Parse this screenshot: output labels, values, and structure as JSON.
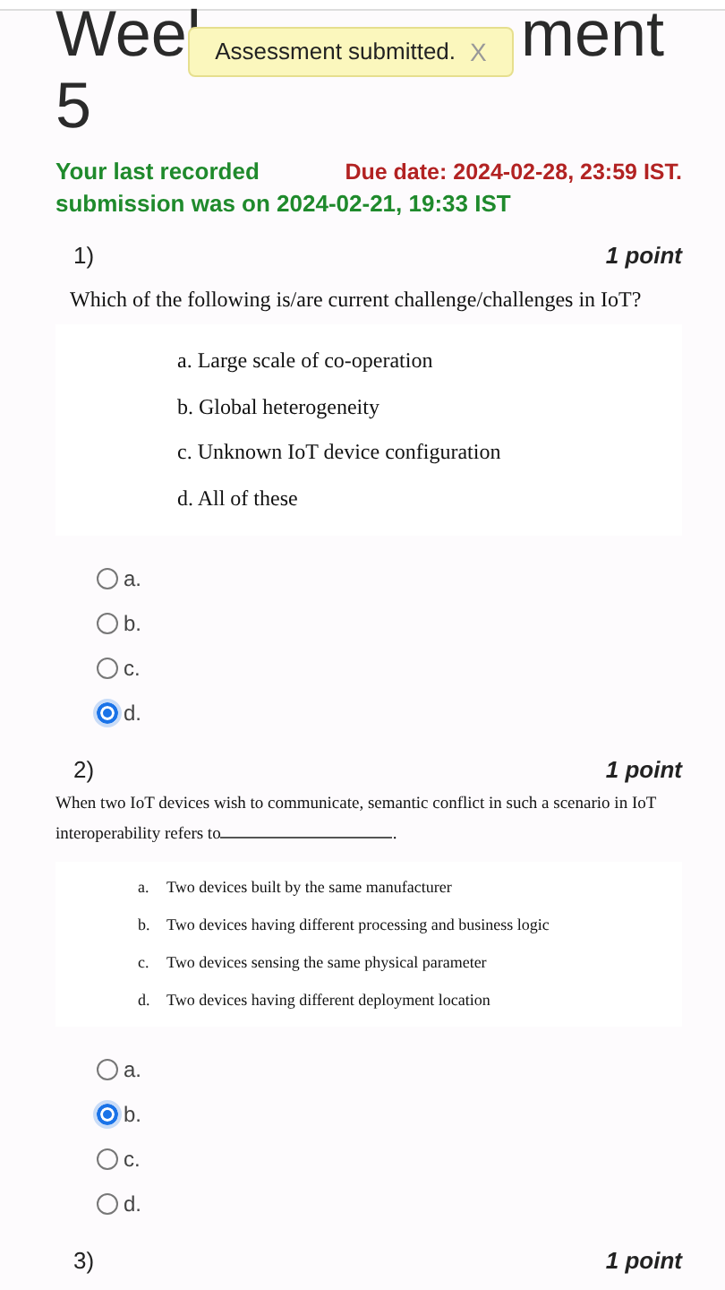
{
  "title": {
    "visible_start": "Weel",
    "visible_end": "ment",
    "line_2": "5"
  },
  "toast": {
    "message": "Assessment submitted.",
    "close": "X"
  },
  "submission_note": [
    "Your last recorded",
    "submission was on 2024-02-21, 19:33 IST"
  ],
  "due_date": "Due date: 2024-02-28, 23:59 IST.",
  "questions": [
    {
      "number": "1)",
      "points": "1 point",
      "kind": "plain",
      "text": "Which of the following is/are current challenge/challenges in IoT?",
      "options": [
        {
          "marker": "a.",
          "text": "Large scale of co-operation"
        },
        {
          "marker": "b.",
          "text": "Global heterogeneity"
        },
        {
          "marker": "c.",
          "text": "Unknown IoT device configuration"
        },
        {
          "marker": "d.",
          "text": "All of these"
        }
      ],
      "choices": [
        {
          "label": "a.",
          "selected": false
        },
        {
          "label": "b.",
          "selected": false
        },
        {
          "label": "c.",
          "selected": false
        },
        {
          "label": "d.",
          "selected": true
        }
      ]
    },
    {
      "number": "2)",
      "points": "1 point",
      "kind": "tabbed",
      "text": "When two IoT devices wish to communicate, semantic conflict in such a scenario in IoT interoperability refers to",
      "after_blank": ".",
      "options": [
        {
          "marker": "a.",
          "text": "Two devices built by the same manufacturer"
        },
        {
          "marker": "b.",
          "text": "Two devices having different processing and business logic"
        },
        {
          "marker": "c.",
          "text": "Two devices sensing the same physical parameter"
        },
        {
          "marker": "d.",
          "text": "Two devices having different deployment location"
        }
      ],
      "choices": [
        {
          "label": "a.",
          "selected": false
        },
        {
          "label": "b.",
          "selected": true
        },
        {
          "label": "c.",
          "selected": false
        },
        {
          "label": "d.",
          "selected": false
        }
      ]
    },
    {
      "number": "3)",
      "points": "1 point",
      "kind": "plain"
    }
  ]
}
